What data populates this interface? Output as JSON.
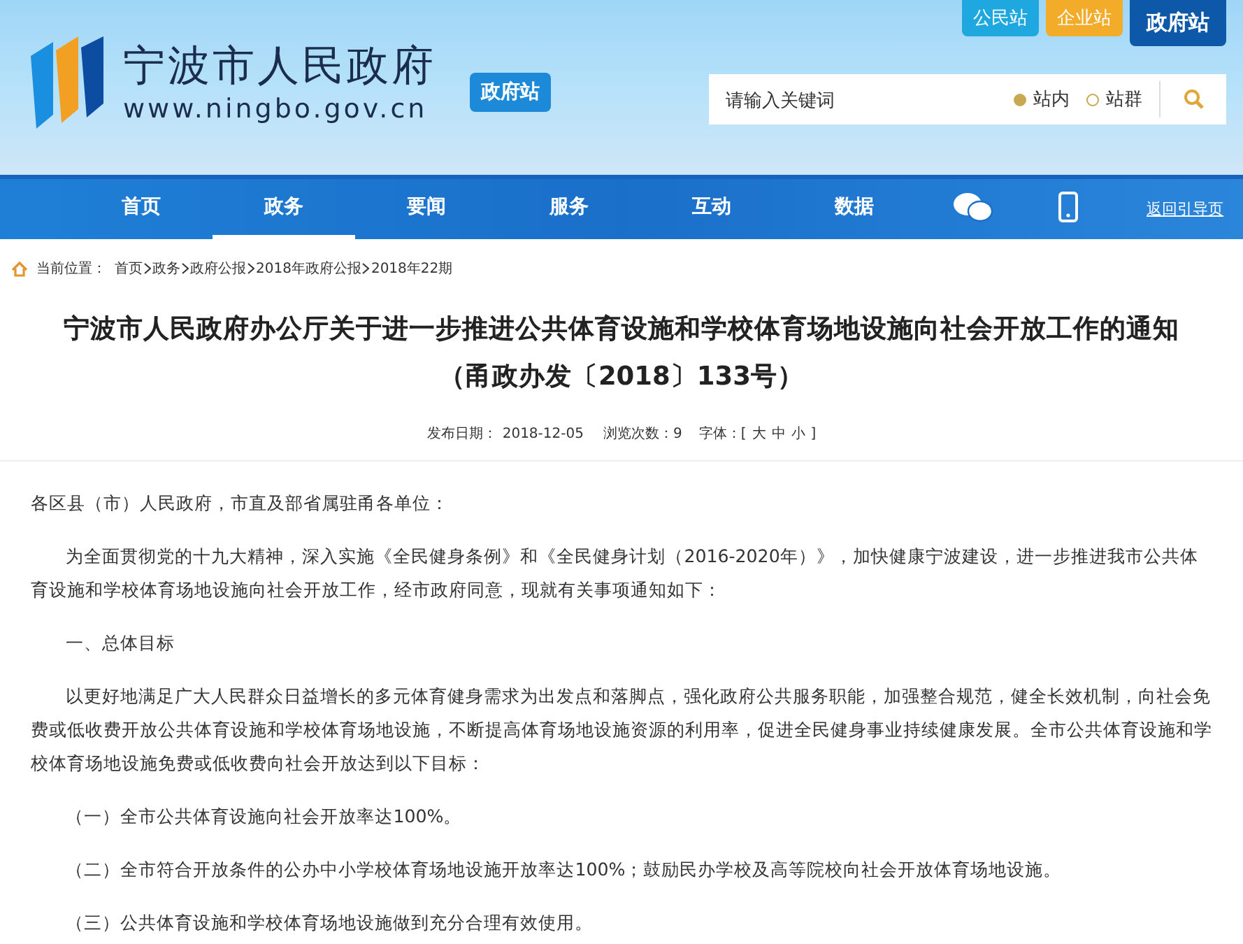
{
  "site_tabs": [
    {
      "label": "公民站",
      "selected": false,
      "color": "#1fa8e0"
    },
    {
      "label": "企业站",
      "selected": false,
      "color": "#f2ac2a"
    },
    {
      "label": "政府站",
      "selected": true,
      "color": "#0d58a8"
    }
  ],
  "logo": {
    "title": "宁波市人民政府",
    "url": "www.ningbo.gov.cn",
    "badge": "政府站"
  },
  "search": {
    "placeholder": "请输入关键词",
    "scopes": [
      {
        "label": "站内",
        "selected": true
      },
      {
        "label": "站群",
        "selected": false
      }
    ]
  },
  "nav": {
    "items": [
      {
        "kind": "text",
        "label": "首页",
        "selected": false
      },
      {
        "kind": "text",
        "label": "政务",
        "selected": true
      },
      {
        "kind": "text",
        "label": "要闻",
        "selected": false
      },
      {
        "kind": "text",
        "label": "服务",
        "selected": false
      },
      {
        "kind": "text",
        "label": "互动",
        "selected": false
      },
      {
        "kind": "text",
        "label": "数据",
        "selected": false
      },
      {
        "kind": "wechat",
        "selected": false
      },
      {
        "kind": "phone",
        "selected": false
      }
    ],
    "back_link": "返回引导页"
  },
  "breadcrumb": {
    "label": "当前位置：",
    "path": [
      "首页",
      "政务",
      "政府公报",
      "2018年政府公报",
      "2018年22期"
    ]
  },
  "article": {
    "title": [
      "宁波市人民政府办公厅关于进一步推进公共体育设施和学校体育场地设施向社会开放工作的通知",
      "（甬政办发〔2018〕133号）"
    ],
    "meta": {
      "date_label": "发布日期：",
      "date": "2018-12-05",
      "views_label": "浏览次数：9",
      "font_label": "字体：[",
      "sizes": [
        "大",
        "中",
        "小"
      ],
      "font_end": "]"
    },
    "paragraphs": [
      {
        "kind": "salutation",
        "text": "各区县（市）人民政府，市直及部省属驻甬各单位："
      },
      {
        "kind": "body",
        "text": "为全面贯彻党的十九大精神，深入实施《全民健身条例》和《全民健身计划（2016-2020年）》，加快健康宁波建设，进一步推进我市公共体育设施和学校体育场地设施向社会开放工作，经市政府同意，现就有关事项通知如下："
      },
      {
        "kind": "body",
        "text": "一、总体目标"
      },
      {
        "kind": "body",
        "text": "以更好地满足广大人民群众日益增长的多元体育健身需求为出发点和落脚点，强化政府公共服务职能，加强整合规范，健全长效机制，向社会免费或低收费开放公共体育设施和学校体育场地设施，不断提高体育场地设施资源的利用率，促进全民健身事业持续健康发展。全市公共体育设施和学校体育场地设施免费或低收费向社会开放达到以下目标："
      },
      {
        "kind": "body",
        "text": "（一）全市公共体育设施向社会开放率达100%。"
      },
      {
        "kind": "body",
        "text": "（二）全市符合开放条件的公办中小学校体育场地设施开放率达100%；鼓励民办学校及高等院校向社会开放体育场地设施。"
      },
      {
        "kind": "body",
        "text": "（三）公共体育设施和学校体育场地设施做到充分合理有效使用。"
      }
    ]
  }
}
